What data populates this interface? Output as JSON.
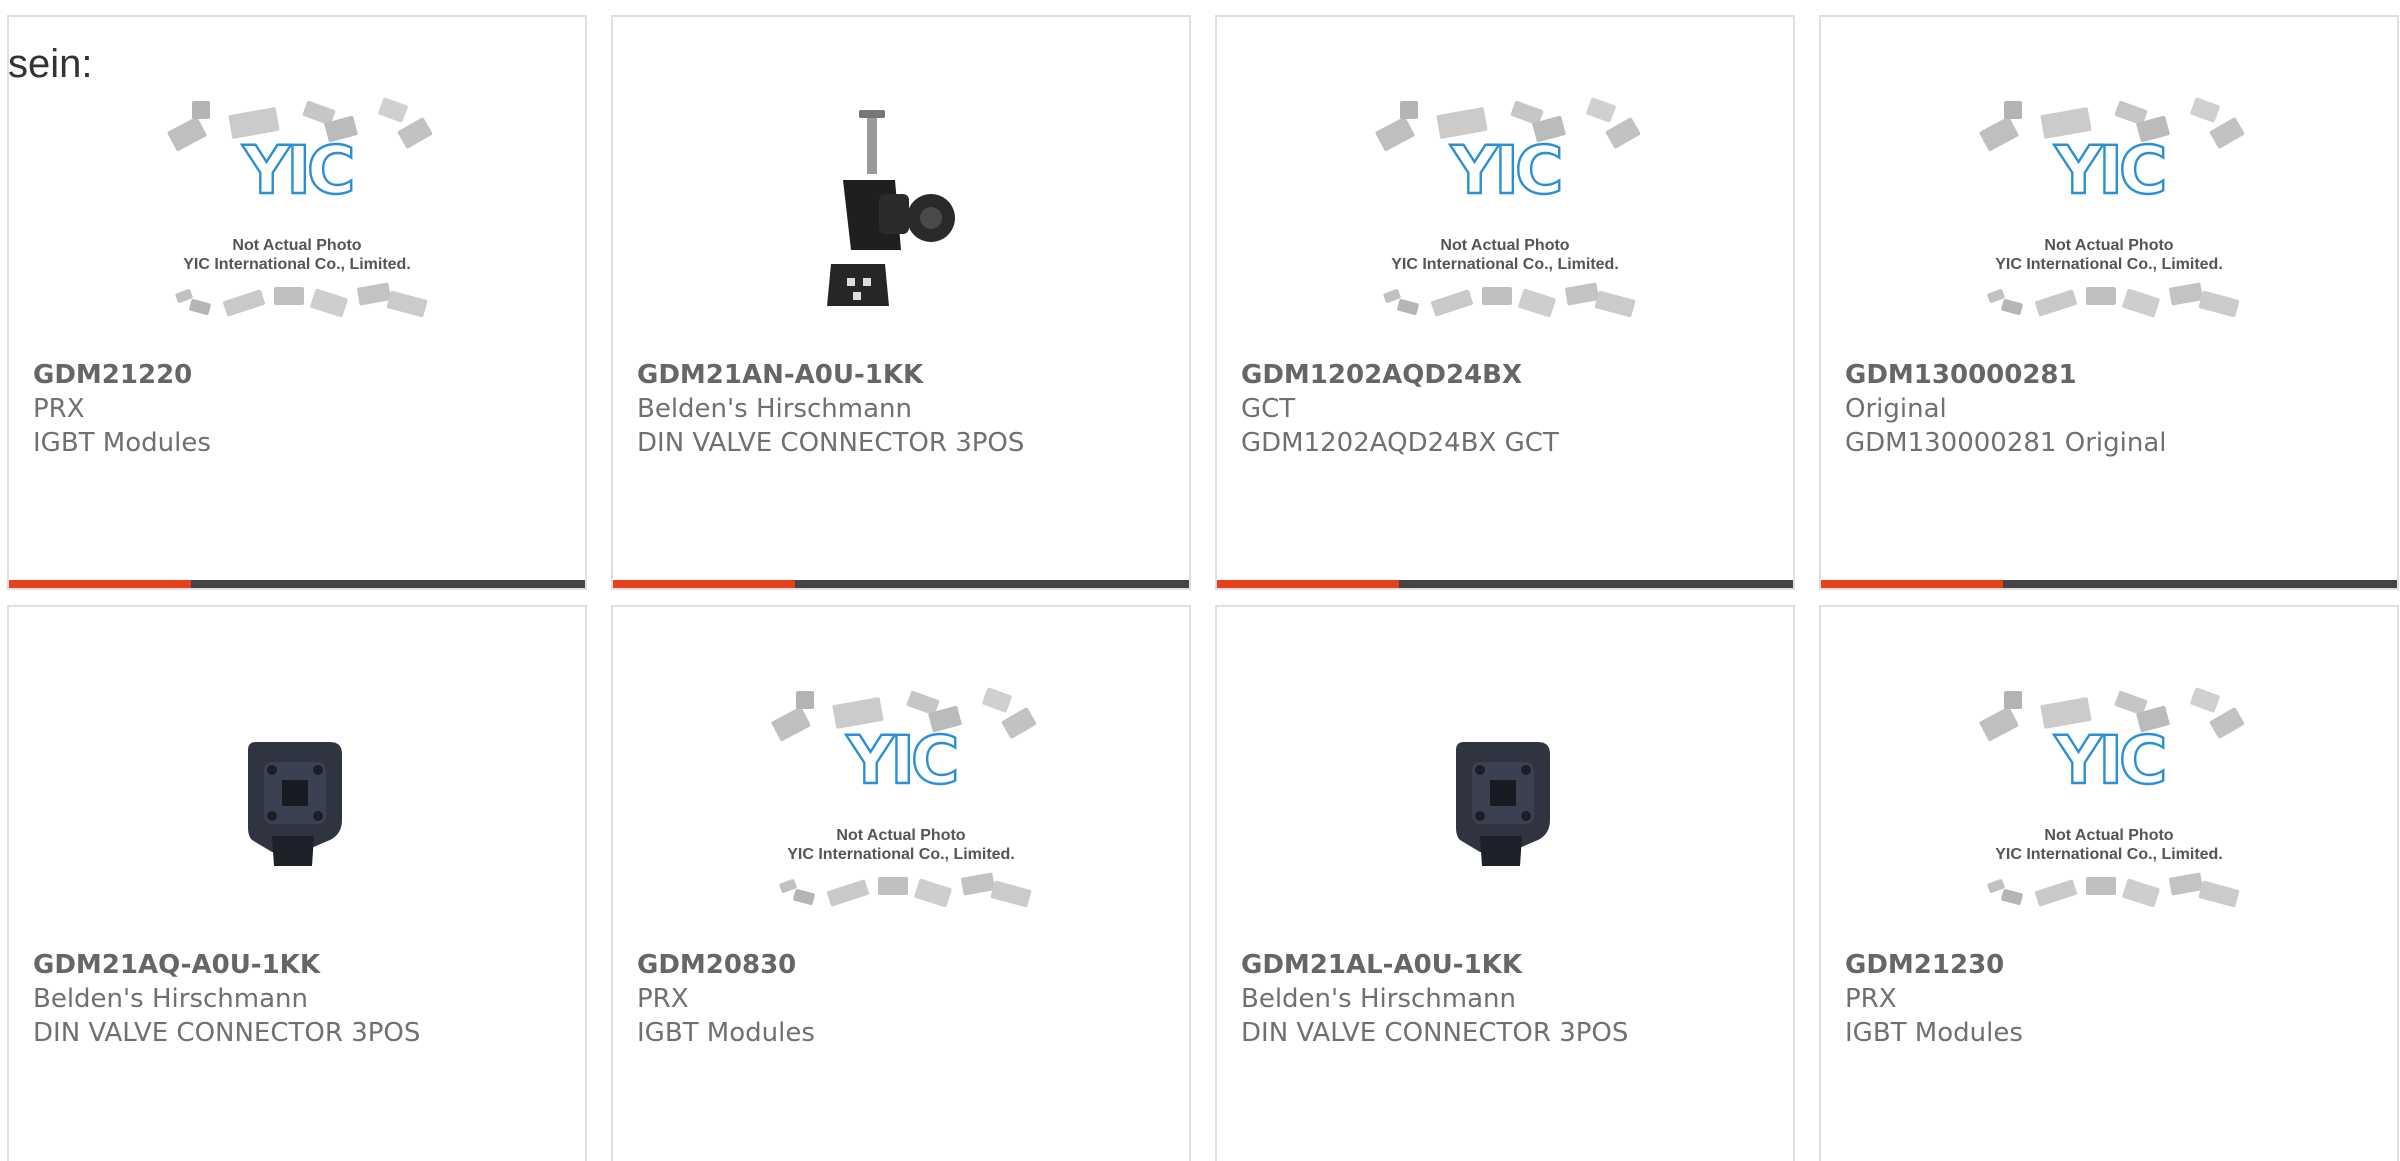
{
  "intro_text": "sein:",
  "placeholder": {
    "line1": "Not Actual Photo",
    "line2": "YIC International Co., Limited."
  },
  "colors": {
    "accent": "#e8401c",
    "bar_dark": "#444444",
    "border": "#e0e0e0",
    "logo_blue": "#2a8fd6"
  },
  "products": [
    {
      "part_number": "GDM21220",
      "manufacturer": "PRX",
      "description": "IGBT Modules",
      "image": "yic-placeholder"
    },
    {
      "part_number": "GDM21AN-A0U-1KK",
      "manufacturer": "Belden's Hirschmann",
      "description": "DIN VALVE CONNECTOR 3POS",
      "image": "din-valve-connector-kit"
    },
    {
      "part_number": "GDM1202AQD24BX",
      "manufacturer": "GCT",
      "description": "GDM1202AQD24BX GCT",
      "image": "yic-placeholder"
    },
    {
      "part_number": "GDM130000281",
      "manufacturer": "Original",
      "description": "GDM130000281 Original",
      "image": "yic-placeholder"
    },
    {
      "part_number": "GDM21AQ-A0U-1KK",
      "manufacturer": "Belden's Hirschmann",
      "description": "DIN VALVE CONNECTOR 3POS",
      "image": "din-valve-connector"
    },
    {
      "part_number": "GDM20830",
      "manufacturer": "PRX",
      "description": "IGBT Modules",
      "image": "yic-placeholder"
    },
    {
      "part_number": "GDM21AL-A0U-1KK",
      "manufacturer": "Belden's Hirschmann",
      "description": "DIN VALVE CONNECTOR 3POS",
      "image": "din-valve-connector"
    },
    {
      "part_number": "GDM21230",
      "manufacturer": "PRX",
      "description": "IGBT Modules",
      "image": "yic-placeholder"
    }
  ]
}
